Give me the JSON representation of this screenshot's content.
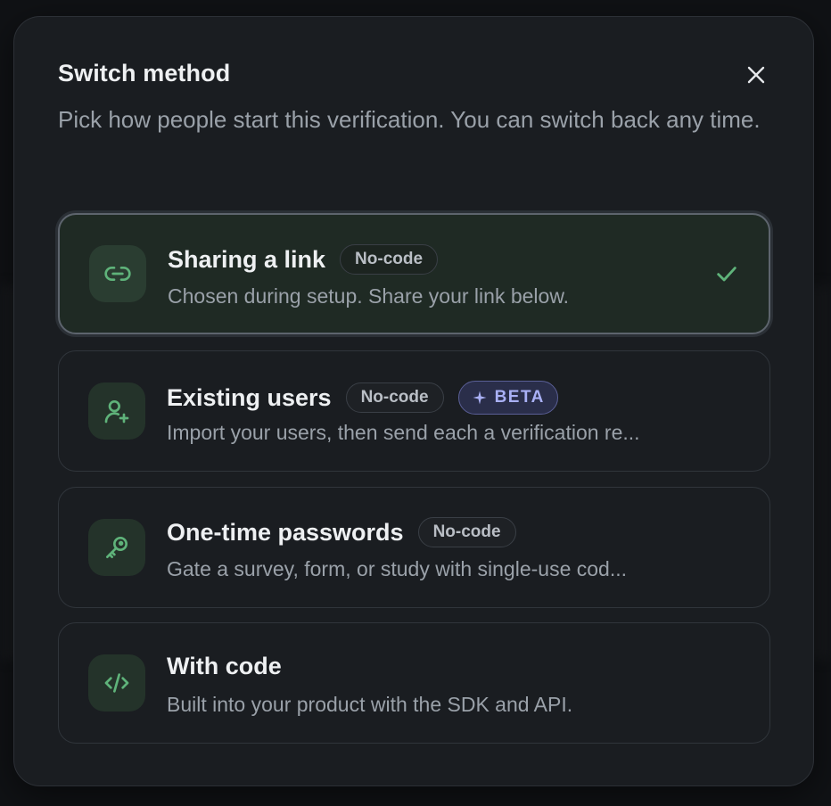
{
  "dialog": {
    "title": "Switch method",
    "subtitle": "Pick how people start this verification. You can switch back any time."
  },
  "options": [
    {
      "title": "Sharing a link",
      "tag": "No-code",
      "description": "Chosen during setup. Share your link below.",
      "icon": "link-icon",
      "selected": true
    },
    {
      "title": "Existing users",
      "tag": "No-code",
      "badge": "BETA",
      "description": "Import your users, then send each a verification re...",
      "icon": "user-plus-icon",
      "selected": false
    },
    {
      "title": "One-time passwords",
      "tag": "No-code",
      "description": "Gate a survey, form, or study with single-use cod...",
      "icon": "key-icon",
      "selected": false
    },
    {
      "title": "With code",
      "description": "Built into your product with the SDK and API.",
      "icon": "code-icon",
      "selected": false
    }
  ],
  "colors": {
    "accent_green": "#5fb37a",
    "beta_purple": "#a9b0f5",
    "modal_bg": "#1a1d21"
  }
}
